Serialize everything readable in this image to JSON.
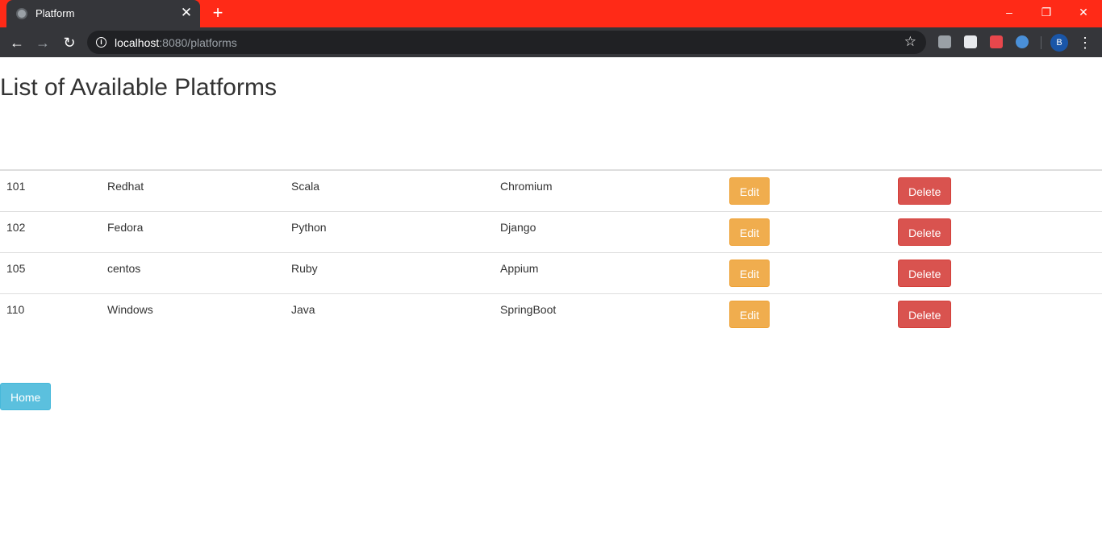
{
  "browser": {
    "tab_title": "Platform",
    "url_host": "localhost",
    "url_rest": ":8080/platforms",
    "profile_initial": "B"
  },
  "page": {
    "heading": "List of Available Platforms",
    "edit_label": "Edit",
    "delete_label": "Delete",
    "home_label": "Home",
    "rows": [
      {
        "id": "101",
        "os": "Redhat",
        "language": "Scala",
        "framework": "Chromium"
      },
      {
        "id": "102",
        "os": "Fedora",
        "language": "Python",
        "framework": "Django"
      },
      {
        "id": "105",
        "os": "centos",
        "language": "Ruby",
        "framework": "Appium"
      },
      {
        "id": "110",
        "os": "Windows",
        "language": "Java",
        "framework": "SpringBoot"
      }
    ]
  },
  "colors": {
    "titlebar": "#ff2a17",
    "edit": "#f0ad4e",
    "delete": "#d9534f",
    "home": "#5bc0de"
  }
}
